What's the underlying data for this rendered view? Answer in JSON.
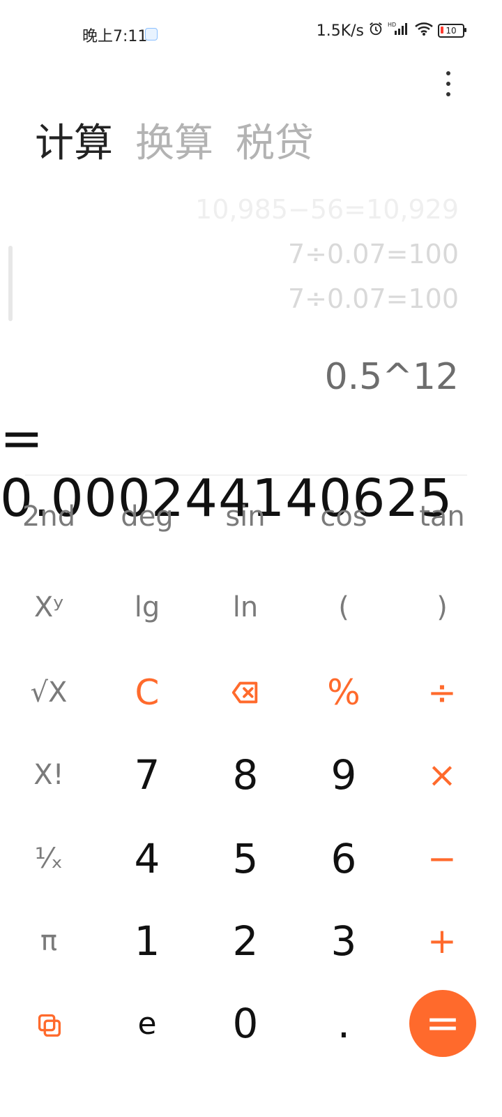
{
  "status": {
    "time": "晚上7:11",
    "net_speed": "1.5K/s",
    "hd": "HD",
    "battery": "10"
  },
  "tabs": [
    "计算",
    "换算",
    "税贷"
  ],
  "history": [
    "10,985−56=10,929",
    "7÷0.07=100",
    "7÷0.07=100"
  ],
  "current": {
    "expression": "0.5^12",
    "result": "= 0.000244140625"
  },
  "keys": {
    "row1": [
      "2nd",
      "deg",
      "sin",
      "cos",
      "tan"
    ],
    "row2": [
      "Xʸ",
      "lg",
      "ln",
      "(",
      ")"
    ],
    "row3": [
      "√X",
      "C",
      "⌫",
      "%",
      "÷"
    ],
    "row4": [
      "X!",
      "7",
      "8",
      "9",
      "×"
    ],
    "row5": [
      "¹⁄ₓ",
      "4",
      "5",
      "6",
      "−"
    ],
    "row6": [
      "π",
      "1",
      "2",
      "3",
      "+"
    ],
    "row7": [
      "⇄",
      "e",
      "0",
      ".",
      "="
    ]
  },
  "colors": {
    "accent": "#ff6a2c",
    "text": "#111111",
    "muted": "#7a7a7a"
  }
}
